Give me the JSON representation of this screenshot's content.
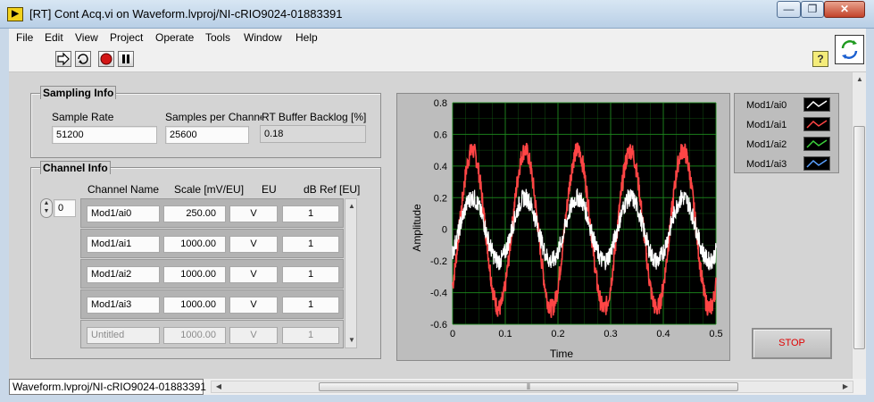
{
  "window": {
    "title": "[RT] Cont Acq.vi on Waveform.lvproj/NI-cRIO9024-01883391",
    "app_icon_glyph": "▶",
    "minimize_glyph": "—",
    "maximize_glyph": "❐",
    "close_glyph": "✕"
  },
  "menu": [
    "File",
    "Edit",
    "View",
    "Project",
    "Operate",
    "Tools",
    "Window",
    "Help"
  ],
  "toolbar": {
    "run_icon": "run-arrow-icon",
    "run_continuous_icon": "run-continuously-icon",
    "abort_icon": "abort-stop-icon",
    "pause_icon": "pause-icon",
    "help_glyph": "?"
  },
  "sampling": {
    "title": "Sampling Info",
    "sample_rate_label": "Sample Rate",
    "sample_rate": "51200",
    "samples_per_channel_label": "Samples per Channe",
    "samples_per_channel": "25600",
    "backlog_label": "RT Buffer Backlog [%]",
    "backlog": "0.18"
  },
  "channel": {
    "title": "Channel Info",
    "index": "0",
    "headers": [
      "Channel Name",
      "Scale [mV/EU]",
      "EU",
      "dB Ref [EU]"
    ],
    "rows": [
      {
        "name": "Mod1/ai0",
        "scale": "250.00",
        "eu": "V",
        "dbref": "1"
      },
      {
        "name": "Mod1/ai1",
        "scale": "1000.00",
        "eu": "V",
        "dbref": "1"
      },
      {
        "name": "Mod1/ai2",
        "scale": "1000.00",
        "eu": "V",
        "dbref": "1"
      },
      {
        "name": "Mod1/ai3",
        "scale": "1000.00",
        "eu": "V",
        "dbref": "1"
      },
      {
        "name": "Untitled",
        "scale": "1000.00",
        "eu": "V",
        "dbref": "1"
      }
    ]
  },
  "chart_data": {
    "type": "line",
    "title": "",
    "xlabel": "Time",
    "ylabel": "Amplitude",
    "xlim": [
      0,
      0.5
    ],
    "ylim": [
      -0.6,
      0.8
    ],
    "xticks": [
      "0",
      "0.1",
      "0.2",
      "0.3",
      "0.4",
      "0.5"
    ],
    "yticks": [
      "0.8",
      "0.6",
      "0.4",
      "0.2",
      "0",
      "-0.2",
      "-0.4",
      "-0.6"
    ],
    "grid": true,
    "background": "#000000",
    "grid_color": "#1e8a1e",
    "legend_position": "right, outside",
    "series": [
      {
        "name": "Mod1/ai1",
        "color": "#ff4545",
        "amplitude": 0.5,
        "offset": 0,
        "frequency_hz": 10,
        "noise": 0.06
      },
      {
        "name": "Mod1/ai0",
        "color": "#ffffff",
        "amplitude": 0.2,
        "offset": 0,
        "frequency_hz": 10,
        "noise": 0.06
      }
    ],
    "legend": [
      {
        "name": "Mod1/ai0",
        "color": "#ffffff"
      },
      {
        "name": "Mod1/ai1",
        "color": "#ff4545"
      },
      {
        "name": "Mod1/ai2",
        "color": "#3cd23c"
      },
      {
        "name": "Mod1/ai3",
        "color": "#5aa0ff"
      }
    ]
  },
  "stop_label": "STOP",
  "status": {
    "path": "Waveform.lvproj/NI-cRIO9024-01883391",
    "left_arrow": "◀",
    "right_arrow": "▶",
    "up_arrow": "▲",
    "down_arrow": "▼",
    "grip": "⦀"
  }
}
